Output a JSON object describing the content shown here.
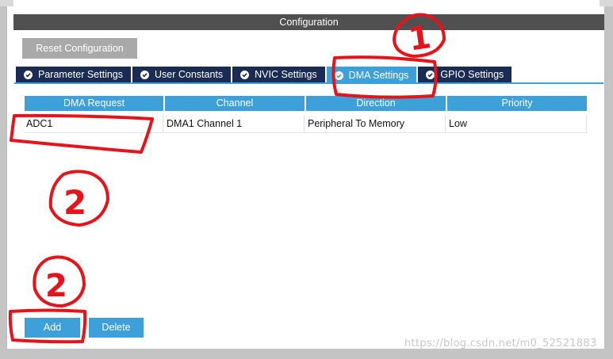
{
  "header": {
    "title": "Configuration"
  },
  "toolbar": {
    "reset_label": "Reset Configuration"
  },
  "tabs": [
    {
      "label": "Parameter Settings",
      "icon": "check-circle-icon",
      "active": false
    },
    {
      "label": "User Constants",
      "icon": "check-circle-icon",
      "active": false
    },
    {
      "label": "NVIC Settings",
      "icon": "check-circle-icon",
      "active": false
    },
    {
      "label": "DMA Settings",
      "icon": "check-circle-icon",
      "active": true
    },
    {
      "label": "GPIO Settings",
      "icon": "check-circle-icon",
      "active": false
    }
  ],
  "table": {
    "columns": [
      "DMA Request",
      "Channel",
      "Direction",
      "Priority"
    ],
    "rows": [
      [
        "ADC1",
        "DMA1 Channel 1",
        "Peripheral To Memory",
        "Low"
      ]
    ]
  },
  "actions": {
    "add_label": "Add",
    "delete_label": "Delete"
  },
  "annotations": {
    "mark1": "1",
    "mark2": "2",
    "mark3": "2"
  },
  "watermark": "https://blog.csdn.net/m0_52521883",
  "colors": {
    "header_bg": "#505050",
    "tab_bg": "#1a2c53",
    "accent": "#3ea0d8",
    "reset_bg": "#a9a9a9",
    "annotation": "#e5141b"
  }
}
